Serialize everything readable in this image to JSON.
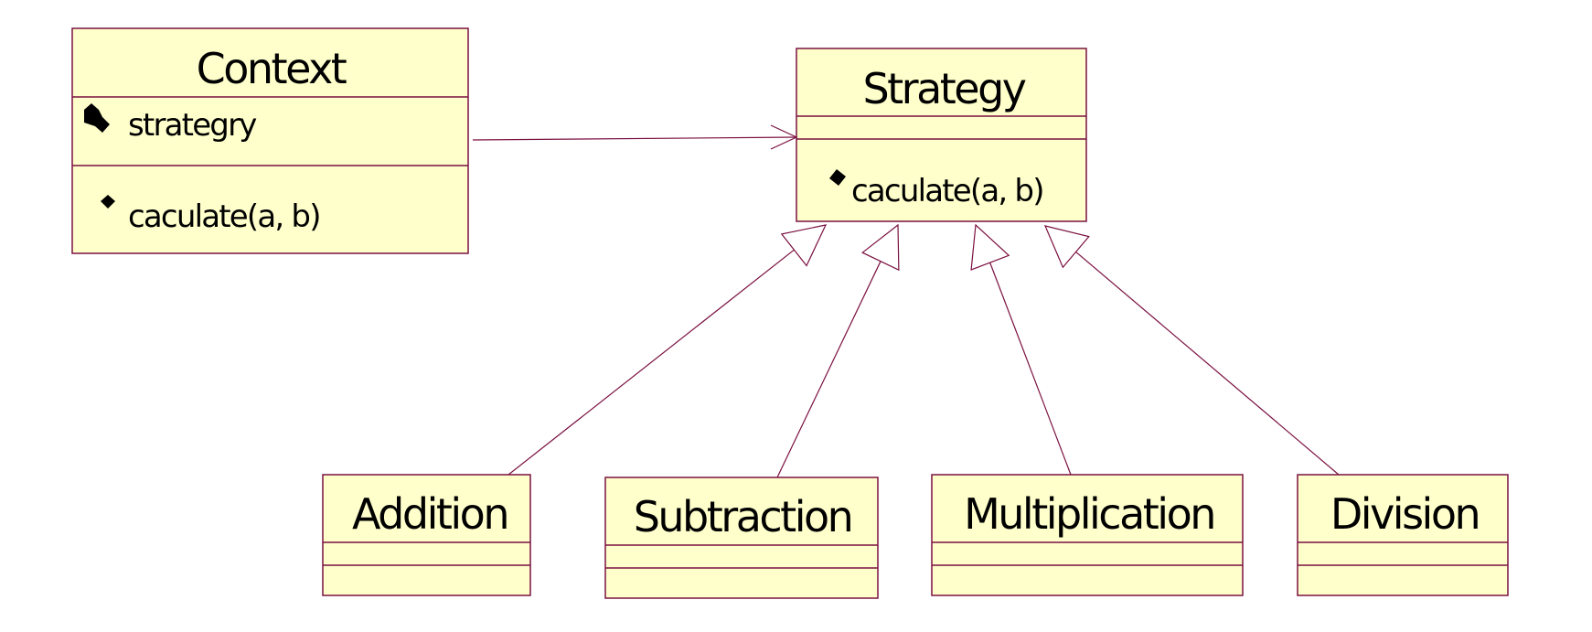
{
  "classes": {
    "context": {
      "name": "Context",
      "attributes": [
        {
          "icon": "private-attribute-icon",
          "label": "strategry"
        }
      ],
      "operations": [
        {
          "icon": "public-operation-icon",
          "label": "caculate(a, b)"
        }
      ]
    },
    "strategy": {
      "name": "Strategy",
      "attributes": [],
      "operations": [
        {
          "icon": "public-operation-icon",
          "label": "caculate(a, b)"
        }
      ]
    },
    "addition": {
      "name": "Addition"
    },
    "subtraction": {
      "name": "Subtraction"
    },
    "multiplication": {
      "name": "Multiplication"
    },
    "division": {
      "name": "Division"
    }
  },
  "relationships": [
    {
      "type": "association",
      "from": "Context",
      "to": "Strategy"
    },
    {
      "type": "generalization",
      "from": "Addition",
      "to": "Strategy"
    },
    {
      "type": "generalization",
      "from": "Subtraction",
      "to": "Strategy"
    },
    {
      "type": "generalization",
      "from": "Multiplication",
      "to": "Strategy"
    },
    {
      "type": "generalization",
      "from": "Division",
      "to": "Strategy"
    }
  ],
  "colors": {
    "fill": "#ffffcc",
    "stroke": "#7a1040"
  }
}
